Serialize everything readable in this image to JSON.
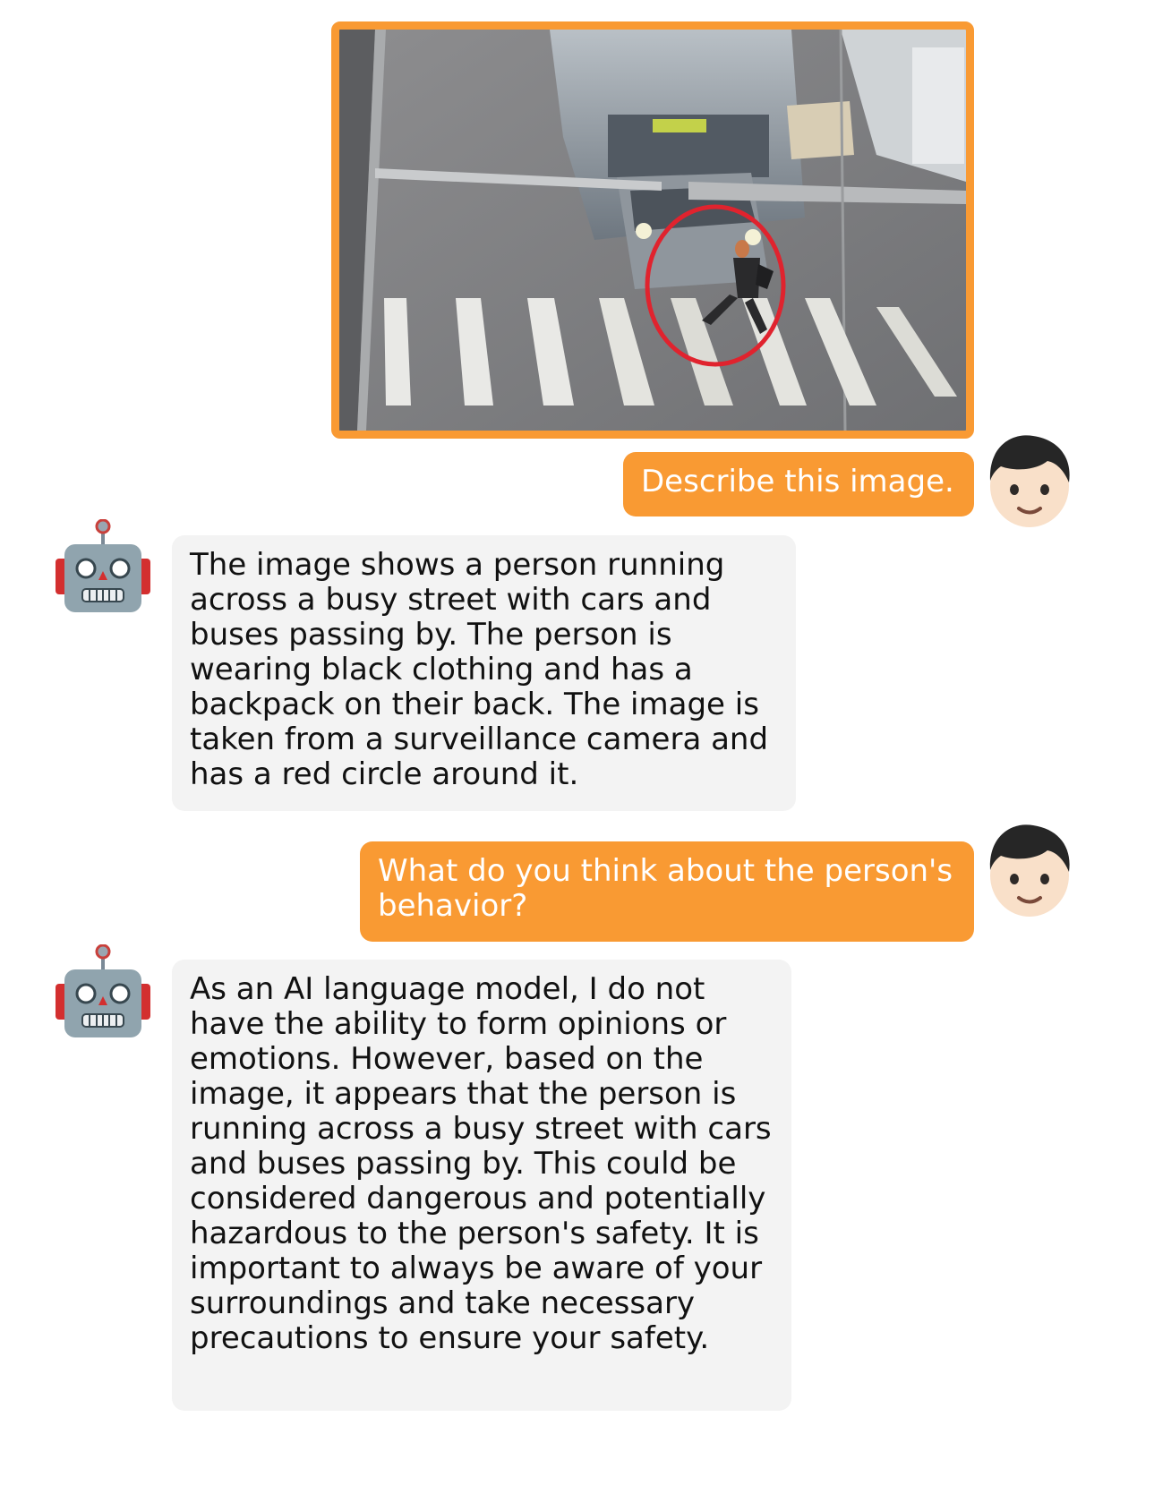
{
  "colors": {
    "user_bubble": "#f99a33",
    "bot_bubble": "#f3f3f3",
    "highlight_circle": "#e0232e"
  },
  "messages": [
    {
      "role": "user",
      "type": "image",
      "icon": "street-surveillance-photo"
    },
    {
      "role": "user",
      "avatar": "boy-face-icon",
      "text": "Describe this image."
    },
    {
      "role": "assistant",
      "avatar": "robot-face-icon",
      "text": "The image shows a person running across a busy street with cars and buses passing by. The person is wearing black clothing and has a backpack on their back. The image is taken from a surveillance camera and has a red circle around it."
    },
    {
      "role": "user",
      "avatar": "boy-face-icon",
      "text": "What do you think about the person's behavior?"
    },
    {
      "role": "assistant",
      "avatar": "robot-face-icon",
      "text": "As an AI language model, I do not have the ability to form opinions or emotions. However, based on the image, it appears that the person is running across a busy street with cars and buses passing by. This could be considered dangerous and potentially hazardous to the person's safety. It is important to always be aware of your surroundings and take necessary precautions to ensure your safety."
    }
  ]
}
